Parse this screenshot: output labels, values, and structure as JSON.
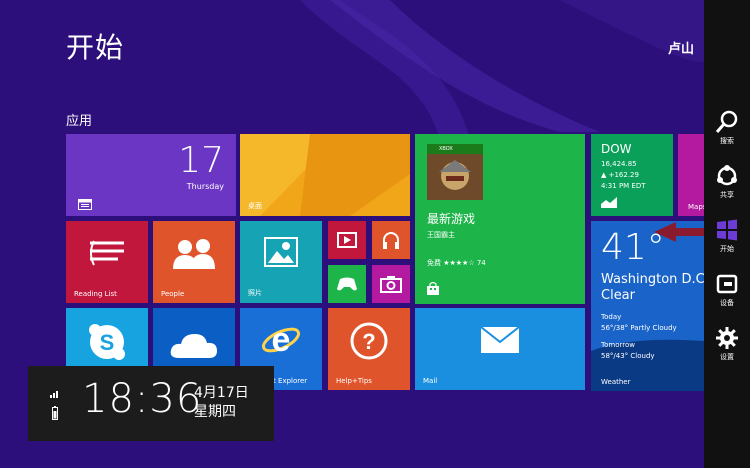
{
  "start_title": "开始",
  "user_name": "卢山",
  "group_label": "应用",
  "colors": {
    "background": "#2c0f7a",
    "charms_bar": "#111111",
    "accent_arrow": "#8a1a2e"
  },
  "tiles": {
    "calendar": {
      "day": "17",
      "weekday": "Thursday",
      "icon": "calendar-icon"
    },
    "desktop": {
      "label": "桌面"
    },
    "game": {
      "badge": "XBOX",
      "headline": "最新游戏",
      "sub": "王国霸主",
      "price_rating": "免费 ★★★★☆ 74",
      "icon": "store-bag-icon"
    },
    "finance": {
      "ticker": "DOW",
      "value": "16,424.85",
      "change": "▲ +162.29",
      "time": "4:31 PM EDT",
      "icon": "chart-icon"
    },
    "maps": {
      "label": "Maps"
    },
    "reading_list": {
      "label": "Reading List"
    },
    "people": {
      "label": "People"
    },
    "photos": {
      "label": "照片"
    },
    "video": {
      "icon": "video-icon"
    },
    "music": {
      "icon": "headphones-icon"
    },
    "games": {
      "icon": "controller-icon"
    },
    "camera": {
      "icon": "camera-icon"
    },
    "skype": {
      "icon": "skype-icon"
    },
    "onedrive": {
      "icon": "cloud-icon"
    },
    "ie": {
      "label": "Internet Explorer"
    },
    "help": {
      "label": "Help+Tips"
    },
    "mail": {
      "label": "Mail"
    },
    "weather": {
      "temp": "41°",
      "city": "Washington D.C.",
      "condition": "Clear",
      "today_label": "Today",
      "today": "56°/38° Partly Cloudy",
      "tomorrow_label": "Tomorrow",
      "tomorrow": "58°/43° Cloudy",
      "label": "Weather"
    }
  },
  "charms": {
    "search": "搜索",
    "share": "共享",
    "start": "开始",
    "devices": "设备",
    "settings": "设置"
  },
  "clock": {
    "time": "18:36",
    "date": "4月17日",
    "weekday": "星期四"
  }
}
